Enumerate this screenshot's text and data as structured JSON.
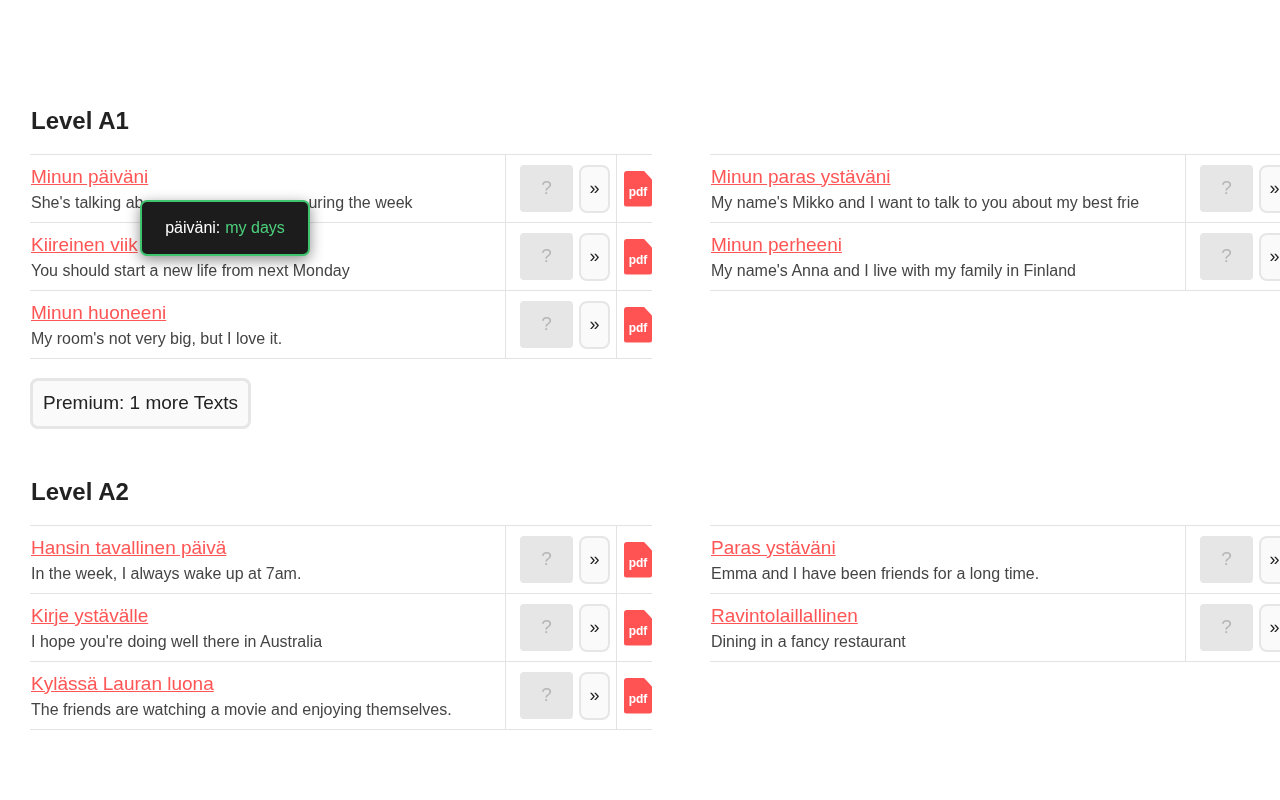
{
  "levels": [
    {
      "heading": "Level A1",
      "columns": [
        [
          {
            "title": "Minun päiväni",
            "description_parts": [
              "She's talking ab",
              "uring the week"
            ],
            "tooltip": {
              "word": "päiväni:",
              "translation": "my days"
            },
            "actions": {
              "help": "?",
              "next": "»",
              "pdf": "pdf"
            }
          },
          {
            "title": "Kiireinen viik",
            "description_parts": [
              "You should start a new life from next Monday"
            ],
            "actions": {
              "help": "?",
              "next": "»",
              "pdf": "pdf"
            }
          },
          {
            "title": "Minun huoneeni",
            "description_parts": [
              "My room's not very big, but I love it."
            ],
            "actions": {
              "help": "?",
              "next": "»",
              "pdf": "pdf"
            }
          }
        ],
        [
          {
            "title": "Minun paras ystäväni",
            "description_parts": [
              "My name's Mikko and I want to talk to you about my best frie"
            ],
            "actions": {
              "help": "?",
              "next": "»"
            }
          },
          {
            "title": "Minun perheeni",
            "description_parts": [
              "My name's Anna and I live with my family in Finland"
            ],
            "actions": {
              "help": "?",
              "next": "»"
            }
          }
        ]
      ],
      "premium": "Premium: 1 more Texts"
    },
    {
      "heading": "Level A2",
      "columns": [
        [
          {
            "title": "Hansin tavallinen päivä",
            "description_parts": [
              "In the week, I always wake up at 7am."
            ],
            "actions": {
              "help": "?",
              "next": "»",
              "pdf": "pdf"
            }
          },
          {
            "title": "Kirje ystävälle",
            "description_parts": [
              "I hope you're doing well there in Australia"
            ],
            "actions": {
              "help": "?",
              "next": "»",
              "pdf": "pdf"
            }
          },
          {
            "title": "Kylässä Lauran luona",
            "description_parts": [
              "The friends are watching a movie and enjoying themselves."
            ],
            "actions": {
              "help": "?",
              "next": "»",
              "pdf": "pdf"
            }
          }
        ],
        [
          {
            "title": "Paras ystäväni",
            "description_parts": [
              "Emma and I have been friends for a long time."
            ],
            "actions": {
              "help": "?",
              "next": "»"
            }
          },
          {
            "title": "Ravintolaillallinen",
            "description_parts": [
              "Dining in a fancy restaurant"
            ],
            "actions": {
              "help": "?",
              "next": "»"
            }
          }
        ]
      ]
    }
  ]
}
